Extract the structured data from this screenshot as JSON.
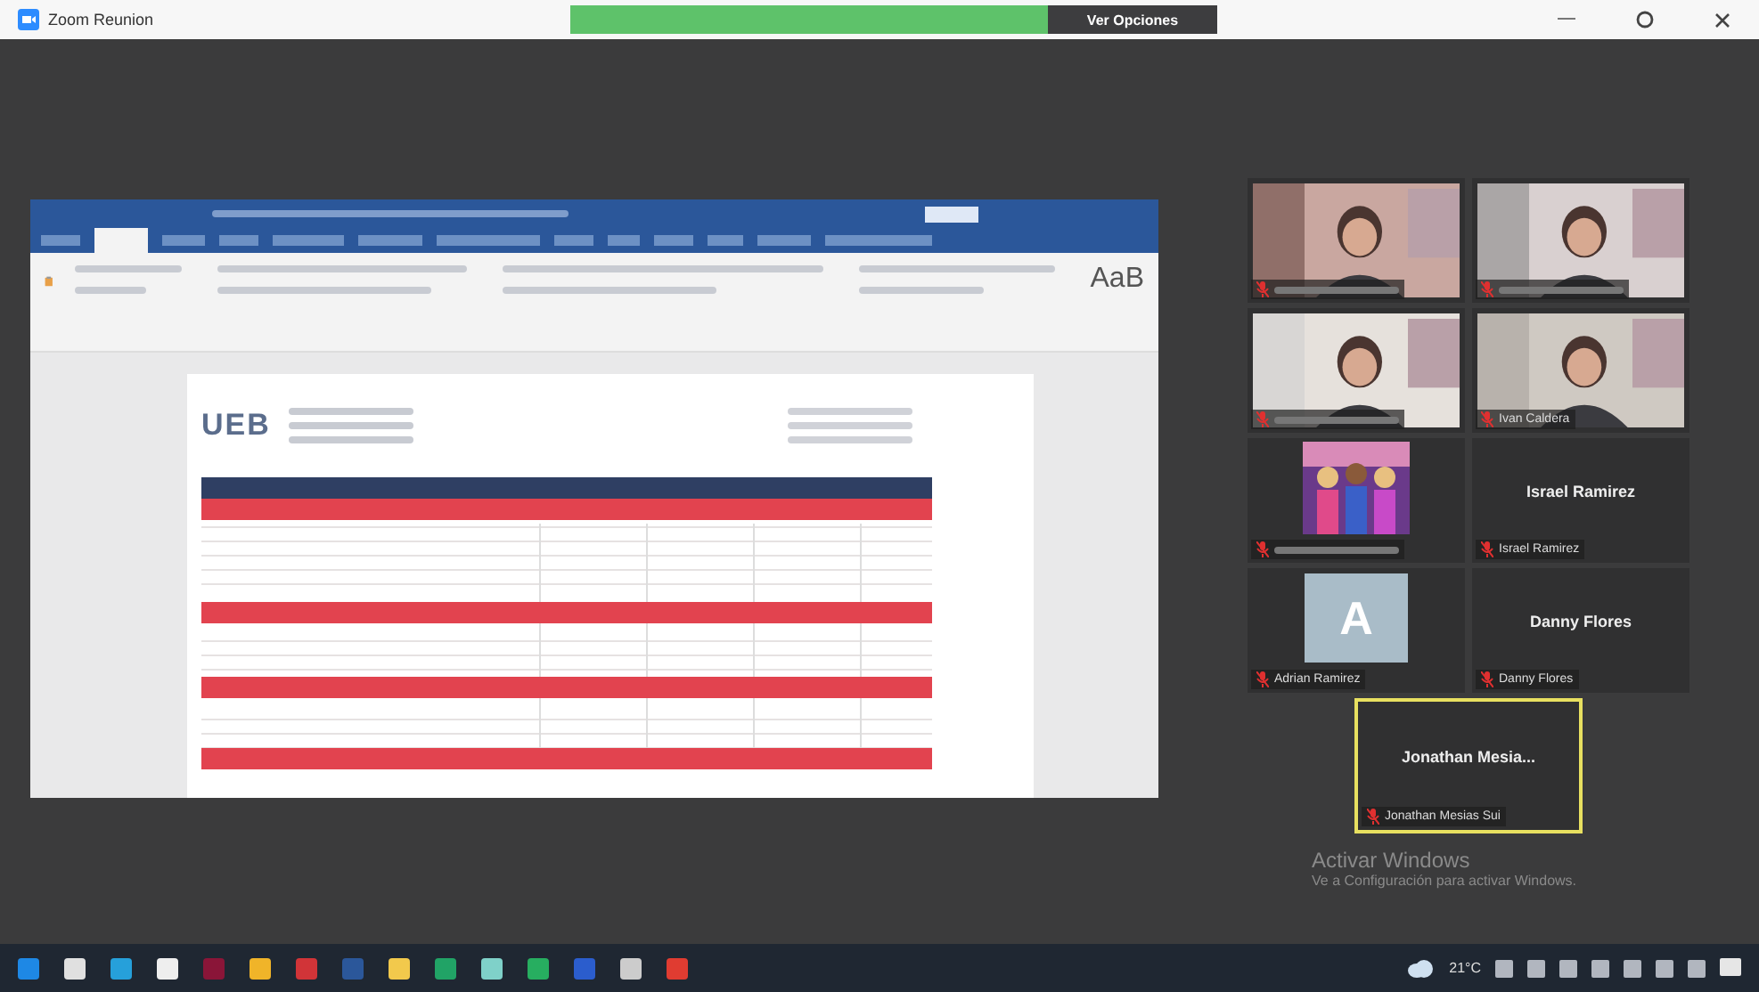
{
  "window": {
    "title": "Zoom Reunion"
  },
  "share_banner": {
    "button": "Ver Opciones"
  },
  "shared_document": {
    "logo": "UEB",
    "style_preview": "AaB",
    "ribbon_tabs": [
      {
        "selected": false
      },
      {
        "selected": true
      },
      {
        "selected": false
      },
      {
        "selected": false
      },
      {
        "selected": false
      },
      {
        "selected": false
      },
      {
        "selected": false
      },
      {
        "selected": false
      },
      {
        "selected": false
      },
      {
        "selected": false
      },
      {
        "selected": false
      },
      {
        "selected": false
      },
      {
        "selected": false
      }
    ]
  },
  "participants": [
    {
      "kind": "video",
      "muted": true,
      "active": false
    },
    {
      "kind": "video",
      "muted": true,
      "active": false
    },
    {
      "kind": "video",
      "muted": true,
      "active": false
    },
    {
      "kind": "video",
      "label": "Ivan Caldera",
      "muted": true,
      "active": false
    },
    {
      "kind": "picture",
      "muted": true,
      "active": false
    },
    {
      "kind": "name",
      "display_name": "Israel Ramirez",
      "label": "Israel Ramirez",
      "muted": true,
      "active": false
    },
    {
      "kind": "avatar",
      "initial": "A",
      "label": "Adrian Ramirez",
      "muted": true,
      "active": false
    },
    {
      "kind": "name",
      "display_name": "Danny Flores",
      "label": "Danny Flores",
      "muted": true,
      "active": false
    },
    {
      "kind": "name",
      "display_name": "Jonathan Mesia...",
      "label": "Jonathan Mesias Sui",
      "muted": true,
      "active": true
    }
  ],
  "activation_notice": {
    "title": "Activar Windows",
    "message": "Ve a Configuración para activar Windows."
  },
  "taskbar": {
    "weather": "21°C"
  }
}
